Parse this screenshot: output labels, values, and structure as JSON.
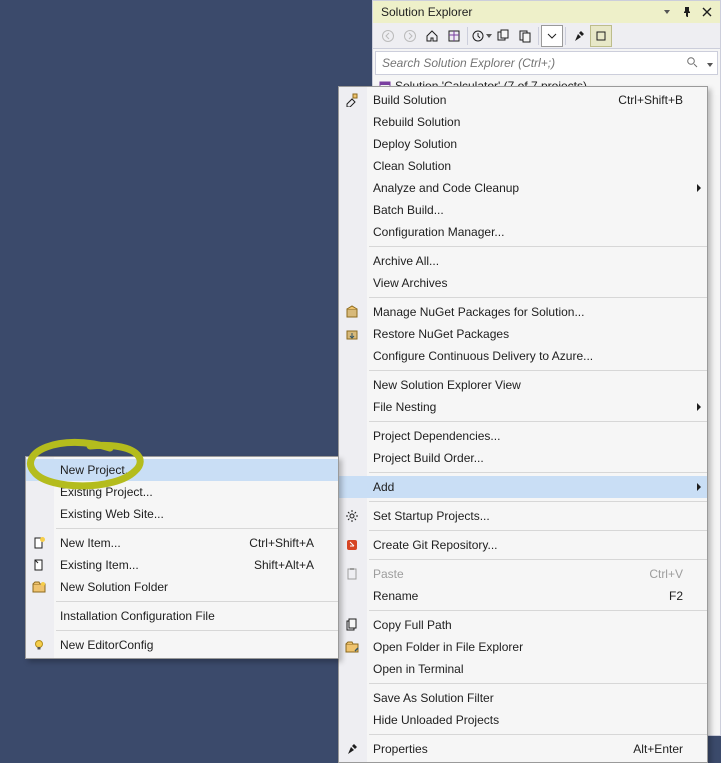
{
  "solutionExplorer": {
    "title": "Solution Explorer",
    "searchPlaceholder": "Search Solution Explorer (Ctrl+;)",
    "treeRootPrefix": "Solution 'Calculator' (7 of 7 projects)"
  },
  "mainMenu": {
    "items": [
      {
        "label": "Build Solution",
        "shortcut": "Ctrl+Shift+B",
        "icon": "build"
      },
      {
        "label": "Rebuild Solution"
      },
      {
        "label": "Deploy Solution"
      },
      {
        "label": "Clean Solution"
      },
      {
        "label": "Analyze and Code Cleanup",
        "submenu": true
      },
      {
        "label": "Batch Build..."
      },
      {
        "label": "Configuration Manager..."
      },
      {
        "sep": true
      },
      {
        "label": "Archive All..."
      },
      {
        "label": "View Archives"
      },
      {
        "sep": true
      },
      {
        "label": "Manage NuGet Packages for Solution...",
        "icon": "nuget"
      },
      {
        "label": "Restore NuGet Packages",
        "icon": "nuget-restore"
      },
      {
        "label": "Configure Continuous Delivery to Azure..."
      },
      {
        "sep": true
      },
      {
        "label": "New Solution Explorer View"
      },
      {
        "label": "File Nesting",
        "submenu": true
      },
      {
        "sep": true
      },
      {
        "label": "Project Dependencies..."
      },
      {
        "label": "Project Build Order..."
      },
      {
        "sep": true
      },
      {
        "label": "Add",
        "submenu": true,
        "highlight": true
      },
      {
        "sep": true
      },
      {
        "label": "Set Startup Projects...",
        "icon": "gear"
      },
      {
        "sep": true
      },
      {
        "label": "Create Git Repository...",
        "icon": "git"
      },
      {
        "sep": true
      },
      {
        "label": "Paste",
        "shortcut": "Ctrl+V",
        "icon": "paste",
        "disabled": true
      },
      {
        "label": "Rename",
        "shortcut": "F2"
      },
      {
        "sep": true
      },
      {
        "label": "Copy Full Path",
        "icon": "copy-path"
      },
      {
        "label": "Open Folder in File Explorer",
        "icon": "explorer"
      },
      {
        "label": "Open in Terminal"
      },
      {
        "sep": true
      },
      {
        "label": "Save As Solution Filter"
      },
      {
        "label": "Hide Unloaded Projects"
      },
      {
        "sep": true
      },
      {
        "label": "Properties",
        "shortcut": "Alt+Enter",
        "icon": "wrench"
      }
    ]
  },
  "addSubmenu": {
    "items": [
      {
        "label": "New Project...",
        "highlight": true
      },
      {
        "label": "Existing Project..."
      },
      {
        "label": "Existing Web Site..."
      },
      {
        "sep": true
      },
      {
        "label": "New Item...",
        "shortcut": "Ctrl+Shift+A",
        "icon": "new-item"
      },
      {
        "label": "Existing Item...",
        "shortcut": "Shift+Alt+A",
        "icon": "existing-item"
      },
      {
        "label": "New Solution Folder",
        "icon": "folder"
      },
      {
        "sep": true
      },
      {
        "label": "Installation Configuration File"
      },
      {
        "sep": true
      },
      {
        "label": "New EditorConfig",
        "icon": "bulb"
      }
    ]
  }
}
